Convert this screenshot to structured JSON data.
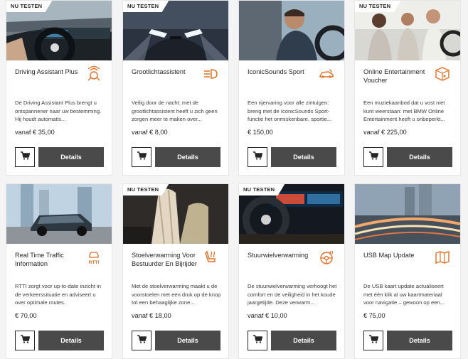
{
  "cards": [
    {
      "badge": "NU TESTEN",
      "title": "Driving Assistant Plus",
      "icon": "driver-assist-icon",
      "desc": "De Driving Assistant Plus brengt u ontspannener naar uw bestemming. Hij houdt automatis...",
      "price": "vanaf € 35,00",
      "details": "Details",
      "cart_icon": "cart-icon"
    },
    {
      "badge": "NU TESTEN",
      "title": "Grootlichtassistent",
      "icon": "high-beam-icon",
      "desc": "Veilig door de nacht: met de grootlichtassistent heeft u zich geen zorgen meer te maken over...",
      "price": "vanaf € 8,00",
      "details": "Details",
      "cart_icon": "cart-icon"
    },
    {
      "badge": "",
      "title": "IconicSounds Sport",
      "icon": "car-sound-icon",
      "desc": "Een rijervaring voor alle zintuigen: breng met de IconicSounds Sport-functie het onmiskenbare, sportie...",
      "price": "€ 150,00",
      "details": "Details",
      "cart_icon": "cart-icon"
    },
    {
      "badge": "NU TESTEN",
      "title": "Online Entertainment Voucher",
      "icon": "music-cube-icon",
      "desc": "Een muziekaanbod dat u vost niet kunt weerstaan: met BMW Online Entertainment heeft u onbeperkt...",
      "price": "vanaf € 225,00",
      "details": "Details",
      "cart_icon": "cart-icon"
    },
    {
      "badge": "",
      "title": "Real Time Traffic Information",
      "icon": "rtti-icon",
      "icon_label": "RTTI",
      "desc": "RTTI zorgt voor up-to-date inzicht in de verkeerssituatie en adviseert u over optimale routes.",
      "price": "€ 70,00",
      "details": "Details",
      "cart_icon": "cart-icon"
    },
    {
      "badge": "NU TESTEN",
      "title": "Stoelverwarming Voor Bestuurder En Bijrijder",
      "icon": "seat-heating-icon",
      "desc": "Met de stoelverwarming maakt u de voorstoelen met een druk op de knop tot een behaaglijke zone...",
      "price": "vanaf € 18,00",
      "details": "Details",
      "cart_icon": "cart-icon"
    },
    {
      "badge": "NU TESTEN",
      "title": "Stuurwielverwarming",
      "icon": "steering-heating-icon",
      "desc": "De stuurwielverwarming verhoogt het comfort en de veiligheid in het koude jaargetijde. Deze verwarm...",
      "price": "vanaf € 10,00",
      "details": "Details",
      "cart_icon": "cart-icon"
    },
    {
      "badge": "",
      "title": "USB Map Update",
      "icon": "map-update-icon",
      "desc": "De USB kaart update actualiseert met één klik al uw kaartmateriaal voor navigatie – gewoon op een...",
      "price": "€ 75,00",
      "details": "Details",
      "cart_icon": "cart-icon"
    }
  ],
  "colors": {
    "accent": "#e96d1f",
    "button": "#4a4a4a",
    "border": "#262626"
  }
}
